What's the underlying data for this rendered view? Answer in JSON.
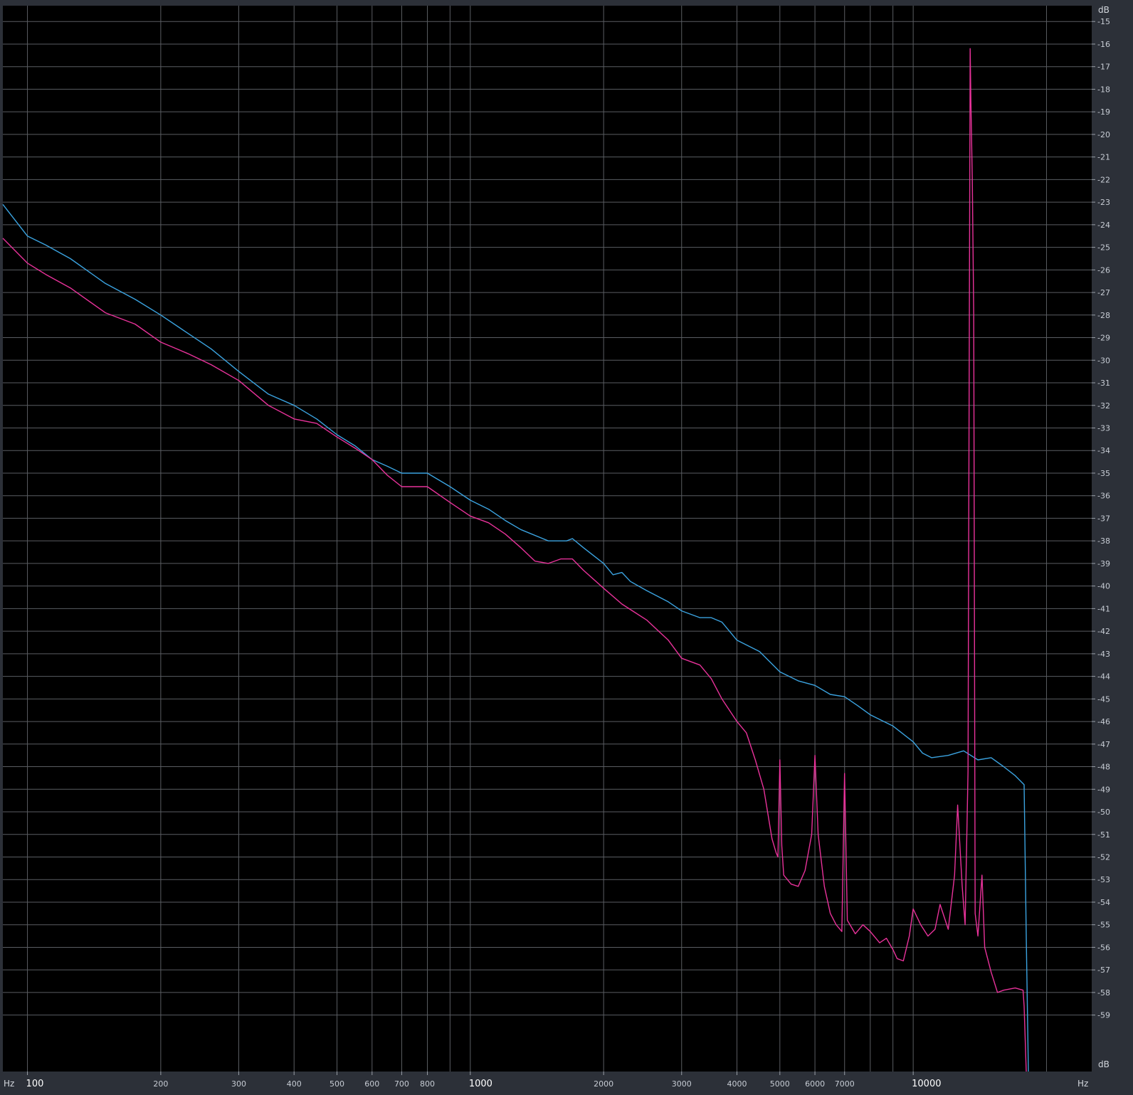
{
  "x_axis": {
    "unit_left": "Hz",
    "unit_right": "Hz",
    "scale": "log",
    "range": [
      88,
      25300
    ],
    "ticks": [
      {
        "value": 100,
        "label": "100"
      },
      {
        "value": 200,
        "label": "200"
      },
      {
        "value": 300,
        "label": "300"
      },
      {
        "value": 400,
        "label": "400"
      },
      {
        "value": 500,
        "label": "500"
      },
      {
        "value": 600,
        "label": "600"
      },
      {
        "value": 700,
        "label": "700"
      },
      {
        "value": 800,
        "label": "800"
      },
      {
        "value": 1000,
        "label": "1000"
      },
      {
        "value": 2000,
        "label": "2000"
      },
      {
        "value": 3000,
        "label": "3000"
      },
      {
        "value": 4000,
        "label": "4000"
      },
      {
        "value": 5000,
        "label": "5000"
      },
      {
        "value": 6000,
        "label": "6000"
      },
      {
        "value": 7000,
        "label": "7000"
      },
      {
        "value": 10000,
        "label": "10000"
      }
    ],
    "minor_gridlines": [
      900,
      8000,
      9000,
      20000
    ]
  },
  "y_axis": {
    "unit_top": "dB",
    "unit_bottom": "dB",
    "range": [
      -61.5,
      -14.3
    ],
    "ticks": [
      -15,
      -16,
      -17,
      -18,
      -19,
      -20,
      -21,
      -22,
      -23,
      -24,
      -25,
      -26,
      -27,
      -28,
      -29,
      -30,
      -31,
      -32,
      -33,
      -34,
      -35,
      -36,
      -37,
      -38,
      -39,
      -40,
      -41,
      -42,
      -43,
      -44,
      -45,
      -46,
      -47,
      -48,
      -49,
      -50,
      -51,
      -52,
      -53,
      -54,
      -55,
      -56,
      -57,
      -58,
      -59
    ]
  },
  "colors": {
    "background": "#000000",
    "grid": "#5a5d62",
    "frame": "#2c3038",
    "blue": "#3ba3e0",
    "magenta": "#e8329a"
  },
  "chart_data": {
    "type": "line",
    "x_scale": "log",
    "xlim": [
      88,
      25300
    ],
    "ylim": [
      -61.5,
      -14.3
    ],
    "grid": true,
    "series": [
      {
        "color": "#3ba3e0",
        "points": [
          [
            88,
            -23.1
          ],
          [
            100,
            -24.5
          ],
          [
            110,
            -24.9
          ],
          [
            125,
            -25.5
          ],
          [
            150,
            -26.6
          ],
          [
            175,
            -27.3
          ],
          [
            200,
            -28.0
          ],
          [
            230,
            -28.8
          ],
          [
            260,
            -29.5
          ],
          [
            300,
            -30.5
          ],
          [
            350,
            -31.5
          ],
          [
            400,
            -32.0
          ],
          [
            450,
            -32.6
          ],
          [
            500,
            -33.3
          ],
          [
            550,
            -33.8
          ],
          [
            600,
            -34.4
          ],
          [
            650,
            -34.7
          ],
          [
            700,
            -35.0
          ],
          [
            800,
            -35.0
          ],
          [
            900,
            -35.6
          ],
          [
            1000,
            -36.2
          ],
          [
            1100,
            -36.6
          ],
          [
            1200,
            -37.1
          ],
          [
            1300,
            -37.5
          ],
          [
            1500,
            -38.0
          ],
          [
            1650,
            -38.0
          ],
          [
            1700,
            -37.9
          ],
          [
            1800,
            -38.3
          ],
          [
            2000,
            -39.0
          ],
          [
            2100,
            -39.5
          ],
          [
            2200,
            -39.4
          ],
          [
            2300,
            -39.8
          ],
          [
            2500,
            -40.2
          ],
          [
            2800,
            -40.7
          ],
          [
            3000,
            -41.1
          ],
          [
            3300,
            -41.4
          ],
          [
            3500,
            -41.4
          ],
          [
            3700,
            -41.6
          ],
          [
            4000,
            -42.4
          ],
          [
            4500,
            -42.9
          ],
          [
            5000,
            -43.8
          ],
          [
            5500,
            -44.2
          ],
          [
            6000,
            -44.4
          ],
          [
            6500,
            -44.8
          ],
          [
            7000,
            -44.9
          ],
          [
            7500,
            -45.3
          ],
          [
            8000,
            -45.7
          ],
          [
            9000,
            -46.2
          ],
          [
            10000,
            -46.9
          ],
          [
            10500,
            -47.4
          ],
          [
            11000,
            -47.6
          ],
          [
            12000,
            -47.5
          ],
          [
            13000,
            -47.3
          ],
          [
            14000,
            -47.7
          ],
          [
            15000,
            -47.6
          ],
          [
            16000,
            -48.0
          ],
          [
            17000,
            -48.4
          ],
          [
            17800,
            -48.8
          ],
          [
            18000,
            -55.5
          ],
          [
            18200,
            -61.5
          ]
        ]
      },
      {
        "color": "#e8329a",
        "points": [
          [
            88,
            -24.6
          ],
          [
            100,
            -25.7
          ],
          [
            110,
            -26.2
          ],
          [
            125,
            -26.8
          ],
          [
            150,
            -27.9
          ],
          [
            175,
            -28.4
          ],
          [
            200,
            -29.2
          ],
          [
            230,
            -29.7
          ],
          [
            260,
            -30.2
          ],
          [
            300,
            -30.9
          ],
          [
            350,
            -32.0
          ],
          [
            400,
            -32.6
          ],
          [
            450,
            -32.8
          ],
          [
            500,
            -33.4
          ],
          [
            550,
            -33.9
          ],
          [
            600,
            -34.4
          ],
          [
            650,
            -35.1
          ],
          [
            700,
            -35.6
          ],
          [
            800,
            -35.6
          ],
          [
            900,
            -36.3
          ],
          [
            1000,
            -36.9
          ],
          [
            1100,
            -37.2
          ],
          [
            1200,
            -37.7
          ],
          [
            1300,
            -38.3
          ],
          [
            1400,
            -38.9
          ],
          [
            1500,
            -39.0
          ],
          [
            1600,
            -38.8
          ],
          [
            1700,
            -38.8
          ],
          [
            1800,
            -39.3
          ],
          [
            2000,
            -40.1
          ],
          [
            2200,
            -40.8
          ],
          [
            2500,
            -41.5
          ],
          [
            2800,
            -42.4
          ],
          [
            3000,
            -43.2
          ],
          [
            3300,
            -43.5
          ],
          [
            3500,
            -44.1
          ],
          [
            3700,
            -45.0
          ],
          [
            4000,
            -46.0
          ],
          [
            4200,
            -46.5
          ],
          [
            4400,
            -47.7
          ],
          [
            4600,
            -49.0
          ],
          [
            4800,
            -51.2
          ],
          [
            4900,
            -51.8
          ],
          [
            4950,
            -52.0
          ],
          [
            5000,
            -47.7
          ],
          [
            5050,
            -51.5
          ],
          [
            5100,
            -52.8
          ],
          [
            5300,
            -53.2
          ],
          [
            5500,
            -53.3
          ],
          [
            5700,
            -52.6
          ],
          [
            5900,
            -51.0
          ],
          [
            6000,
            -47.5
          ],
          [
            6100,
            -51.0
          ],
          [
            6300,
            -53.3
          ],
          [
            6500,
            -54.5
          ],
          [
            6700,
            -55.0
          ],
          [
            6900,
            -55.3
          ],
          [
            7000,
            -48.3
          ],
          [
            7100,
            -54.8
          ],
          [
            7400,
            -55.4
          ],
          [
            7700,
            -55.0
          ],
          [
            8000,
            -55.3
          ],
          [
            8400,
            -55.8
          ],
          [
            8700,
            -55.6
          ],
          [
            9000,
            -56.1
          ],
          [
            9200,
            -56.5
          ],
          [
            9500,
            -56.6
          ],
          [
            9800,
            -55.5
          ],
          [
            10000,
            -54.3
          ],
          [
            10400,
            -55.0
          ],
          [
            10800,
            -55.5
          ],
          [
            11200,
            -55.2
          ],
          [
            11500,
            -54.1
          ],
          [
            12000,
            -55.2
          ],
          [
            12400,
            -52.8
          ],
          [
            12600,
            -49.7
          ],
          [
            12900,
            -53.3
          ],
          [
            13100,
            -55.0
          ],
          [
            13300,
            -48.2
          ],
          [
            13400,
            -26.5
          ],
          [
            13450,
            -16.2
          ],
          [
            13500,
            -18.5
          ],
          [
            13600,
            -22.0
          ],
          [
            13700,
            -28.0
          ],
          [
            13800,
            -54.5
          ],
          [
            14000,
            -55.5
          ],
          [
            14300,
            -52.8
          ],
          [
            14500,
            -56.0
          ],
          [
            15000,
            -57.1
          ],
          [
            15500,
            -58.0
          ],
          [
            16000,
            -57.9
          ],
          [
            17000,
            -57.8
          ],
          [
            17700,
            -57.9
          ],
          [
            17800,
            -58.6
          ],
          [
            18000,
            -61.5
          ]
        ]
      }
    ]
  }
}
